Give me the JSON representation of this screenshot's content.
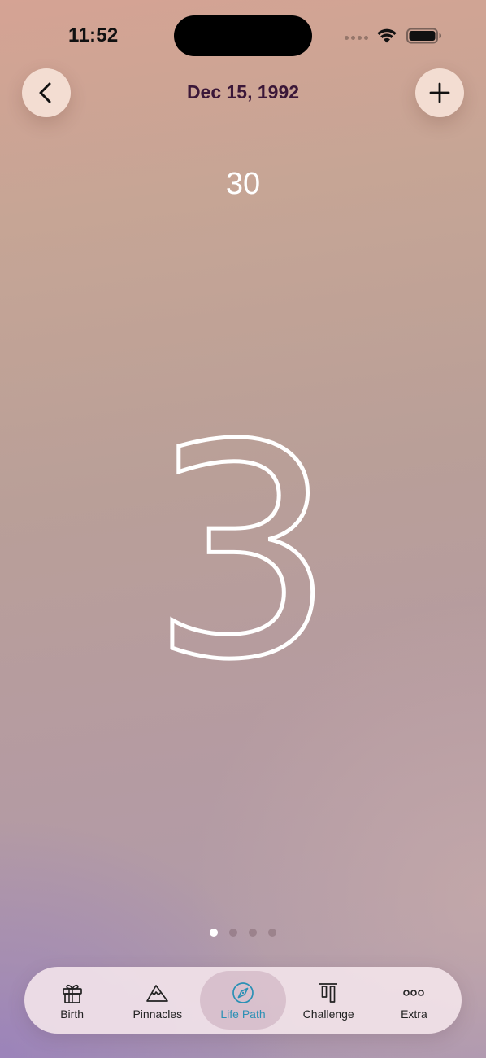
{
  "status_bar": {
    "time": "11:52"
  },
  "header": {
    "title": "Dec 15, 1992",
    "back_icon": "chevron-left-icon",
    "add_icon": "plus-icon"
  },
  "age": "30",
  "main_number": "3",
  "pager": {
    "count": 4,
    "active_index": 0
  },
  "tabs": [
    {
      "label": "Birth",
      "icon": "gift-icon",
      "selected": false
    },
    {
      "label": "Pinnacles",
      "icon": "mountain-icon",
      "selected": false
    },
    {
      "label": "Life Path",
      "icon": "compass-icon",
      "selected": true
    },
    {
      "label": "Challenge",
      "icon": "challenge-bars-icon",
      "selected": false
    },
    {
      "label": "Extra",
      "icon": "ellipsis-icon",
      "selected": false
    }
  ],
  "colors": {
    "title": "#3b1738",
    "accent": "#2b90b5",
    "button_bg": "#f3ddd2",
    "tab_bar_bg": "#f5e6ec"
  }
}
